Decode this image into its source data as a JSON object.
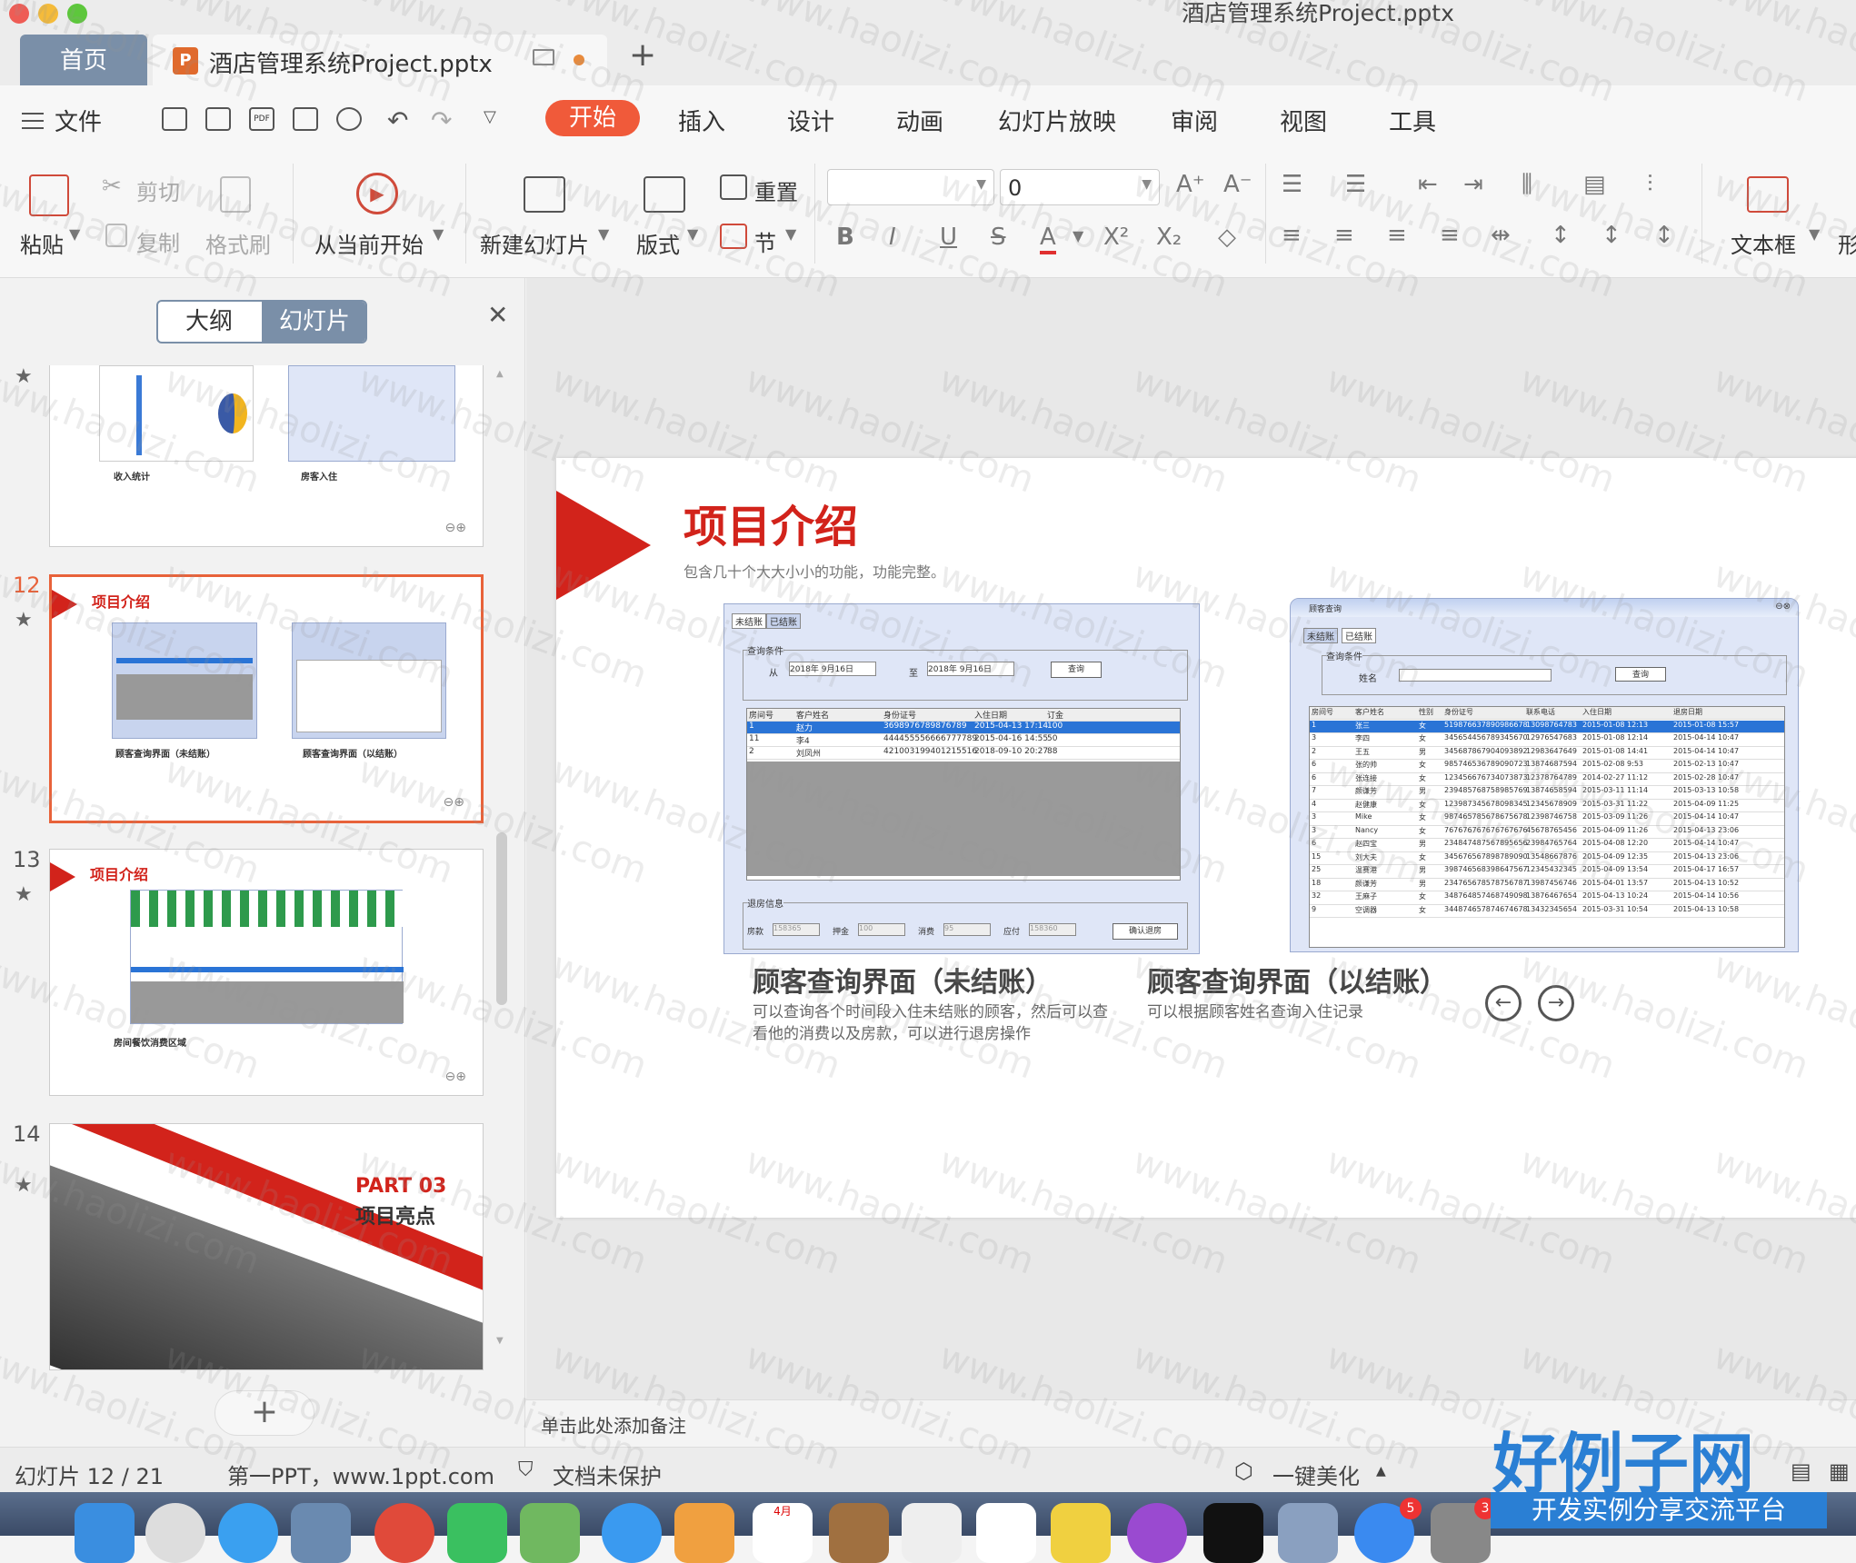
{
  "window": {
    "title": "酒店管理系统Project.pptx"
  },
  "tabs": {
    "home": "首页",
    "doc": "酒店管理系统Project.pptx",
    "plus": "+"
  },
  "menu": {
    "file": "文件",
    "items": [
      "开始",
      "插入",
      "设计",
      "动画",
      "幻灯片放映",
      "审阅",
      "视图",
      "工具"
    ]
  },
  "ribbon": {
    "paste": "粘贴",
    "cut": "剪切",
    "copy": "复制",
    "format_painter": "格式刷",
    "from_current": "从当前开始",
    "new_slide": "新建幻灯片",
    "layout": "版式",
    "reset": "重置",
    "section": "节",
    "font_size": "0",
    "textbox": "文本框",
    "shape_partial": "形"
  },
  "left_panel": {
    "outline_tab": "大纲",
    "slides_tab": "幻灯片",
    "slide11": {
      "cap_left": "收入统计",
      "cap_right": "房客入住"
    },
    "slide12": {
      "num": "12",
      "title": "项目介绍",
      "cap_left": "顾客查询界面（未结账）",
      "cap_right": "顾客查询界面（以结账）"
    },
    "slide13": {
      "num": "13",
      "title": "项目介绍",
      "cap": "房间餐饮消费区域"
    },
    "slide14": {
      "num": "14",
      "part": "PART 03",
      "title": "项目亮点"
    }
  },
  "slide": {
    "title": "项目介绍",
    "subtitle": "包含几十个大大小小的功能，功能完整。",
    "left": {
      "caption": "顾客查询界面（未结账）",
      "desc1": "可以查询各个时间段入住未结账的顾客，然后可以查",
      "desc2": "看他的消费以及房款，可以进行退房操作",
      "tabs": [
        "未结账",
        "已结账"
      ],
      "query_label": "查询条件",
      "from": "从",
      "to": "至",
      "date1": "2018年 9月16日",
      "date2": "2018年 9月16日",
      "query_btn": "查询",
      "headers": [
        "房间号",
        "客户姓名",
        "身份证号",
        "入住日期",
        "订金"
      ],
      "rows": [
        [
          "1",
          "赵力",
          "3698976789876789",
          "2015-04-13 17:14",
          "100"
        ],
        [
          "11",
          "李4",
          "444455556666777789",
          "2015-04-16 14:55",
          "50"
        ],
        [
          "2",
          "刘凤州",
          "421003199401215516",
          "2018-09-10 20:27",
          "88"
        ]
      ],
      "checkout_label": "退房信息",
      "fields": [
        "房款",
        "押金",
        "消费",
        "应付"
      ],
      "field_vals": [
        "158365",
        "100",
        "95",
        "158360"
      ],
      "confirm_btn": "确认退房"
    },
    "right": {
      "caption": "顾客查询界面（以结账）",
      "desc": "可以根据顾客姓名查询入住记录",
      "window_title": "顾客查询",
      "tabs": [
        "未结账",
        "已结账"
      ],
      "query_label": "查询条件",
      "name_label": "姓名",
      "query_btn": "查询",
      "headers": [
        "房间号",
        "客户姓名",
        "性别",
        "身份证号",
        "联系电话",
        "入住日期",
        "退房日期"
      ],
      "rows": [
        [
          "1",
          "张三",
          "女",
          "519876637890986678",
          "13098764783",
          "2015-01-08 12:13",
          "2015-01-08 15:57"
        ],
        [
          "3",
          "李四",
          "女",
          "345654456789345670",
          "12976547683",
          "2015-01-08 12:14",
          "2015-04-14 10:47"
        ],
        [
          "2",
          "王五",
          "男",
          "345687867904093892",
          "12983647649",
          "2015-01-08 14:41",
          "2015-04-14 10:47"
        ],
        [
          "6",
          "张的帅",
          "女",
          "985746536789090723",
          "13874687594",
          "2015-02-08 9:53",
          "2015-02-13 10:47"
        ],
        [
          "6",
          "张连接",
          "女",
          "123456676734073873",
          "12378764789",
          "2014-02-27 11:12",
          "2015-02-28 10:47"
        ],
        [
          "7",
          "颜谦芳",
          "男",
          "239485768758985769",
          "13874658594",
          "2015-03-11 11:14",
          "2015-03-13 10:58"
        ],
        [
          "4",
          "赵健康",
          "女",
          "123987345678098345",
          "12345678909",
          "2015-03-31 11:22",
          "2015-04-09 11:25"
        ],
        [
          "3",
          "Mike",
          "女",
          "987465785678675678",
          "12398746758",
          "2015-03-09 11:26",
          "2015-04-14 10:47"
        ],
        [
          "3",
          "Nancy",
          "女",
          "767676767676767676",
          "45678765456",
          "2015-04-09 11:26",
          "2015-04-13 23:06"
        ],
        [
          "6",
          "赵四宝",
          "男",
          "234847487567895656",
          "23984765764",
          "2015-04-08 12:20",
          "2015-04-14 10:47"
        ],
        [
          "15",
          "刘大夫",
          "女",
          "345676567898789090",
          "13548667876",
          "2015-04-09 12:35",
          "2015-04-13 23:06"
        ],
        [
          "25",
          "温赛港",
          "男",
          "398746568398647567",
          "12345432345",
          "2015-04-09 13:54",
          "2015-04-17 16:57"
        ],
        [
          "18",
          "颜谦芳",
          "男",
          "234765678578756787",
          "13987456746",
          "2015-04-01 13:57",
          "2015-04-13 10:52"
        ],
        [
          "32",
          "王麻子",
          "女",
          "348764857468749098",
          "13876467654",
          "2015-04-13 10:24",
          "2015-04-14 10:56"
        ],
        [
          "9",
          "空调器",
          "女",
          "344874657874674678",
          "13432345654",
          "2015-03-31 10:54",
          "2015-04-13 10:58"
        ]
      ]
    }
  },
  "notes_placeholder": "单击此处添加备注",
  "status": {
    "slide_pos": "幻灯片 12 / 21",
    "template": "第一PPT，www.1ppt.com",
    "protect": "文档未保护",
    "beautify": "一键美化"
  },
  "brand": {
    "big": "好例子网",
    "small": "开发实例分享交流平台"
  },
  "watermark": "www.haolizi.com",
  "dock": {
    "calendar_month": "4月",
    "badge1": "5",
    "badge2": "3"
  },
  "colors": {
    "accent": "#f05a3a",
    "slide_red": "#d2231b",
    "selection": "#2a74d6",
    "brand_blue": "#2a7fd4"
  }
}
